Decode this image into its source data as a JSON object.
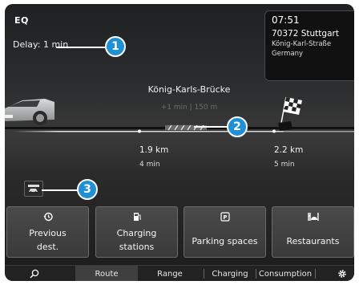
{
  "logo": "EQ",
  "delay": "Delay: 1 min",
  "info_card": {
    "time": "07:51",
    "postal_city": "70372 Stuttgart",
    "street": "König-Karl-Straße",
    "country": "Germany"
  },
  "route": {
    "bridge_name": "König-Karls-Brücke",
    "bridge_detail": "+1 min | 150 m"
  },
  "segments": [
    {
      "distance": "1.9 km",
      "time": "4 min"
    },
    {
      "distance": "2.2 km",
      "time": "5 min"
    }
  ],
  "callouts": [
    "1",
    "2",
    "3"
  ],
  "tiles": [
    {
      "label_line1": "Previous",
      "label_line2": "dest.",
      "icon": "history-icon"
    },
    {
      "label_line1": "Charging",
      "label_line2": "stations",
      "icon": "charging-station-icon"
    },
    {
      "label_line1": "Parking spaces",
      "label_line2": "",
      "icon": "parking-icon"
    },
    {
      "label_line1": "Restaurants",
      "label_line2": "",
      "icon": "restaurant-icon"
    }
  ],
  "tabs": {
    "route": "Route",
    "range": "Range",
    "charging": "Charging",
    "consumption": "Consumption"
  },
  "colors": {
    "callout": "#1f8fd6",
    "background": "#2c2d2e"
  }
}
